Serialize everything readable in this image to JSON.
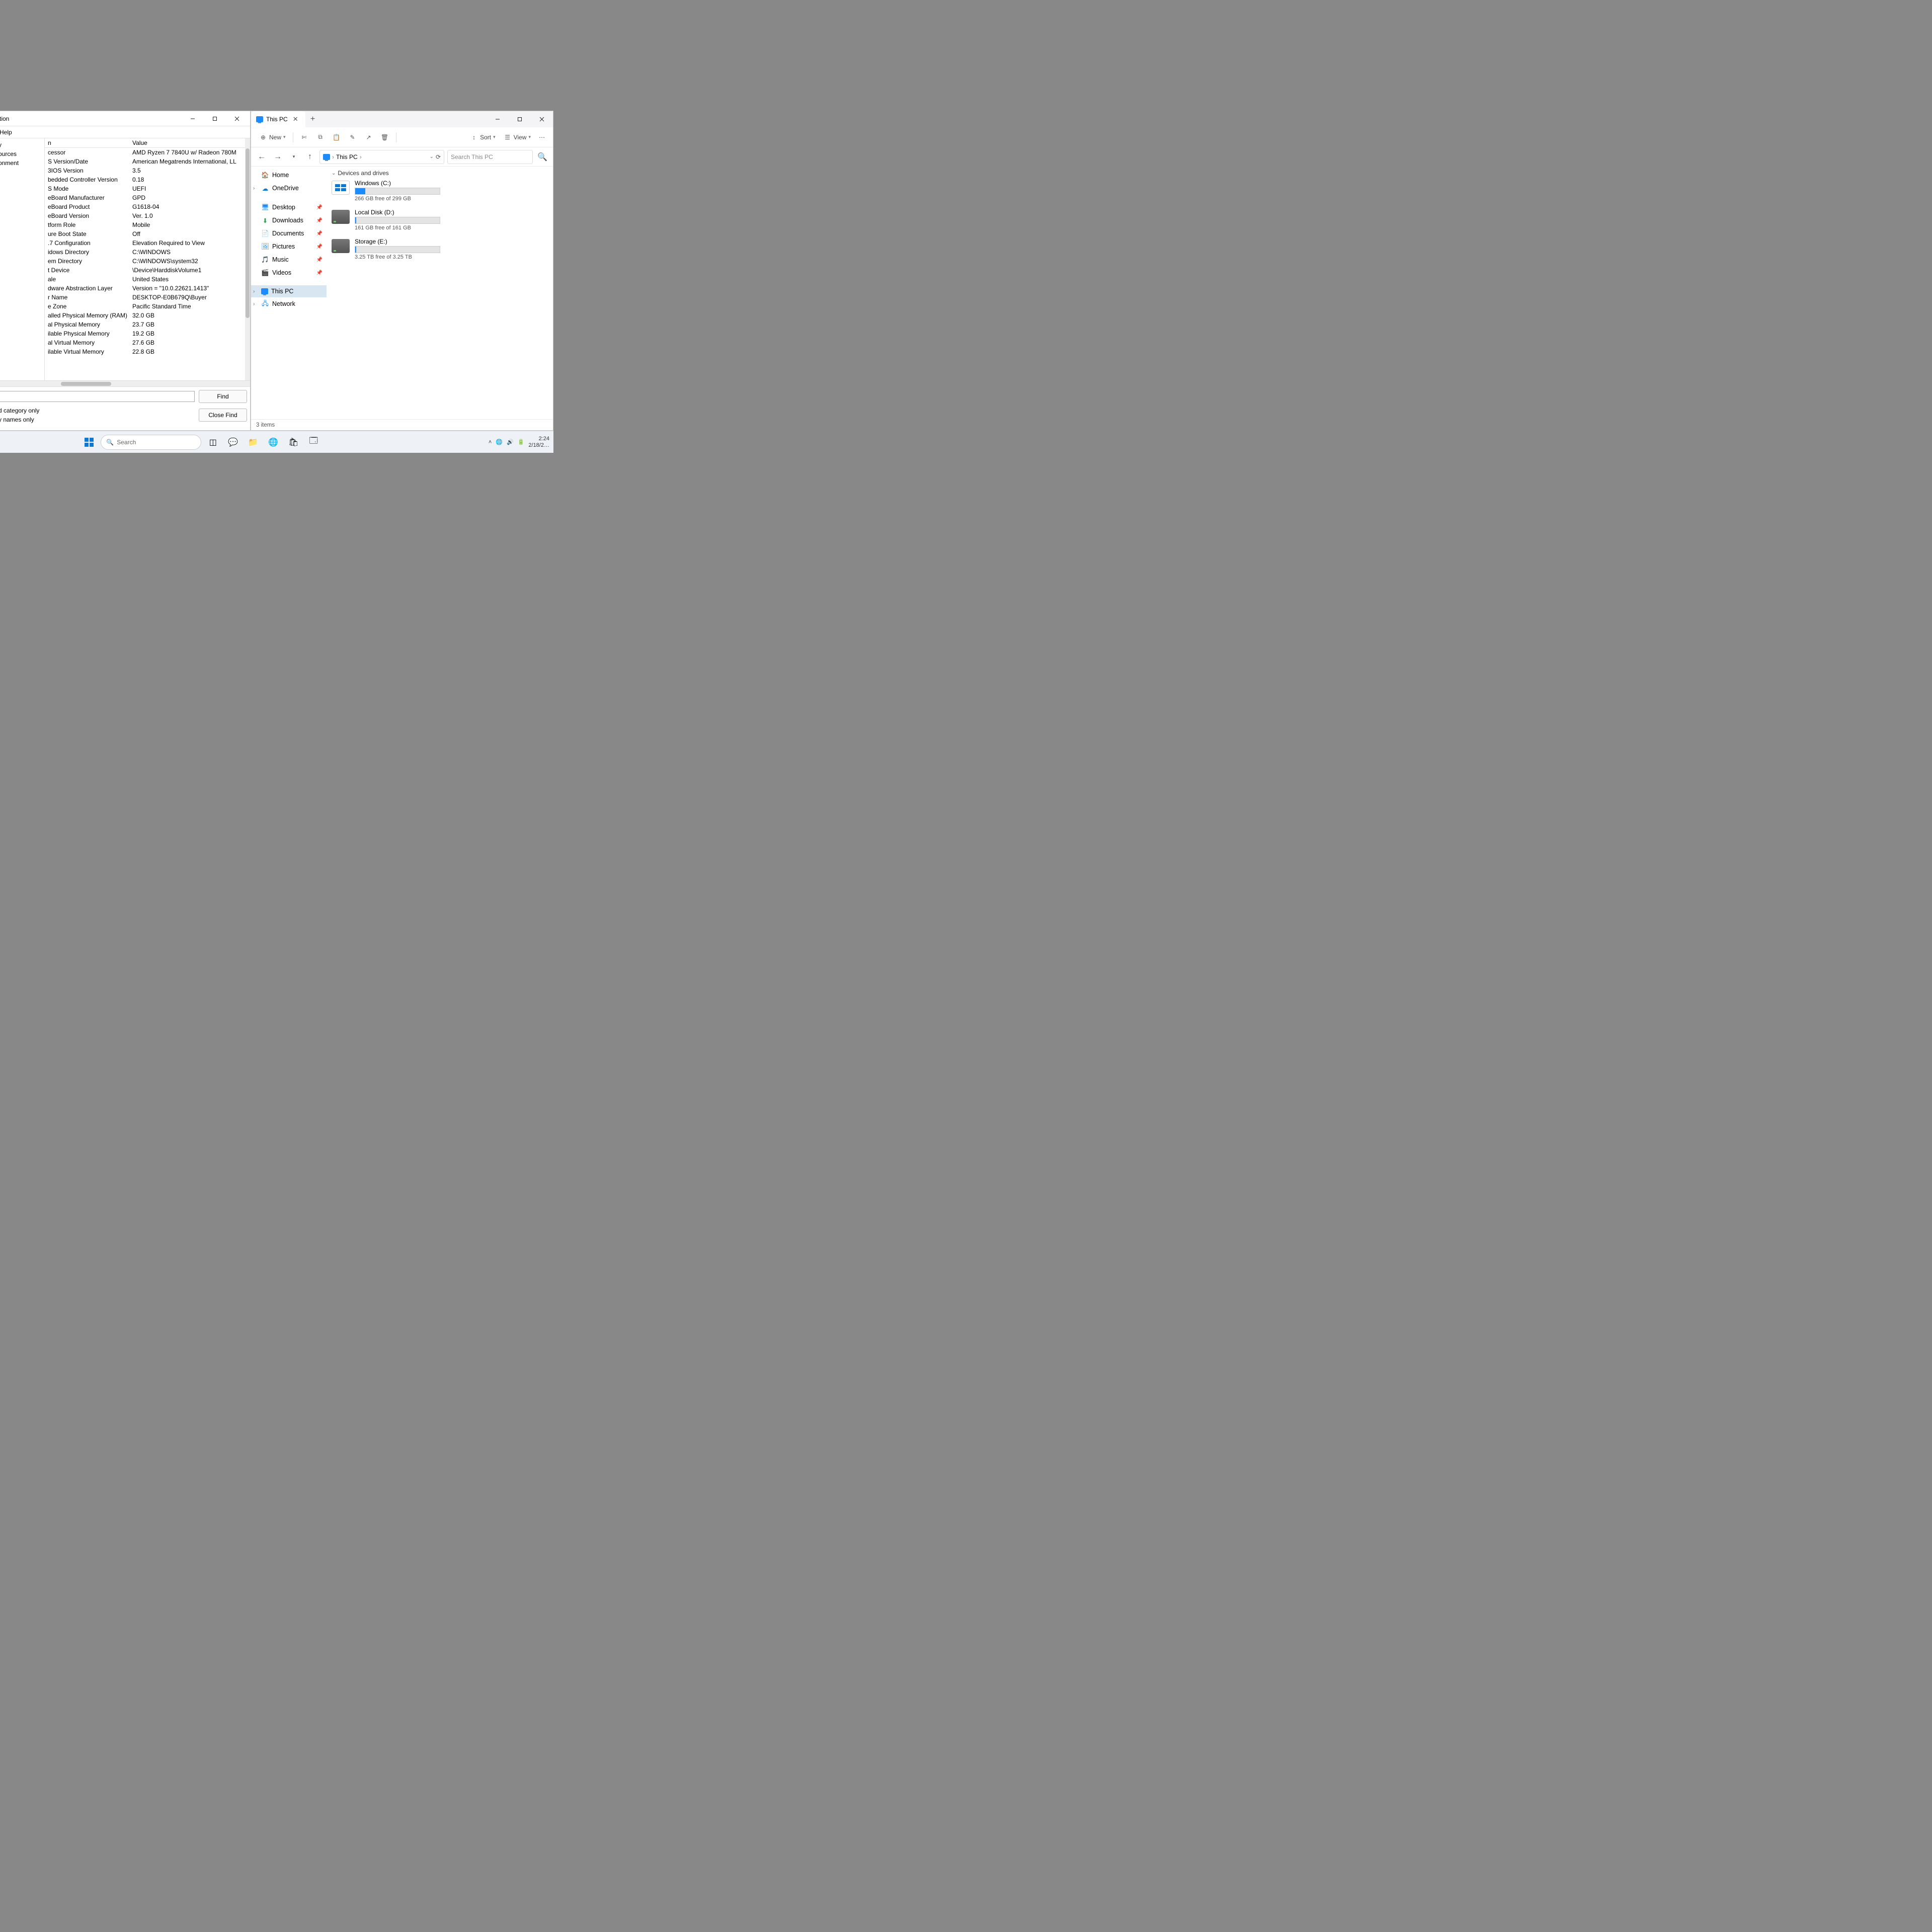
{
  "sysinfo": {
    "title_suffix": "tion",
    "menu": {
      "help": "Help"
    },
    "tree": {
      "row0": "y",
      "row1": "ources",
      "row2": "onment"
    },
    "cols": {
      "key_suffix": "n",
      "val": "Value"
    },
    "rows": [
      {
        "k": "cessor",
        "v": "AMD Ryzen 7 7840U w/ Radeon 780M"
      },
      {
        "k": "S Version/Date",
        "v": "American Megatrends International, LL"
      },
      {
        "k": "3IOS Version",
        "v": "3.5"
      },
      {
        "k": "bedded Controller Version",
        "v": "0.18"
      },
      {
        "k": "S Mode",
        "v": "UEFI"
      },
      {
        "k": "eBoard Manufacturer",
        "v": "GPD"
      },
      {
        "k": "eBoard Product",
        "v": "G1618-04"
      },
      {
        "k": "eBoard Version",
        "v": "Ver. 1.0"
      },
      {
        "k": "tform Role",
        "v": "Mobile"
      },
      {
        "k": "ure Boot State",
        "v": "Off"
      },
      {
        "k": ".7 Configuration",
        "v": "Elevation Required to View"
      },
      {
        "k": "idows Directory",
        "v": "C:\\WINDOWS"
      },
      {
        "k": "em Directory",
        "v": "C:\\WINDOWS\\system32"
      },
      {
        "k": "t Device",
        "v": "\\Device\\HarddiskVolume1"
      },
      {
        "k": "ale",
        "v": "United States"
      },
      {
        "k": "dware Abstraction Layer",
        "v": "Version = \"10.0.22621.1413\""
      },
      {
        "k": "r Name",
        "v": "DESKTOP-E0B679Q\\Buyer"
      },
      {
        "k": "e Zone",
        "v": "Pacific Standard Time"
      },
      {
        "k": "alled Physical Memory (RAM)",
        "v": "32.0 GB"
      },
      {
        "k": "al Physical Memory",
        "v": "23.7 GB"
      },
      {
        "k": "ilable Physical Memory",
        "v": "19.2 GB"
      },
      {
        "k": "al Virtual Memory",
        "v": "27.6 GB"
      },
      {
        "k": "ilable Virtual Memory",
        "v": "22.8 GB"
      }
    ],
    "find_btn": "Find",
    "close_find_btn": "Close Find",
    "check1": "d category only",
    "check2": "y names only"
  },
  "explorer": {
    "tab_title": "This PC",
    "toolbar": {
      "new": "New",
      "sort": "Sort",
      "view": "View"
    },
    "breadcrumb": "This PC",
    "search_placeholder": "Search This PC",
    "nav": {
      "home": "Home",
      "onedrive": "OneDrive",
      "desktop": "Desktop",
      "downloads": "Downloads",
      "documents": "Documents",
      "pictures": "Pictures",
      "music": "Music",
      "videos": "Videos",
      "thispc": "This PC",
      "network": "Network"
    },
    "group": "Devices and drives",
    "drives": [
      {
        "name": "Windows (C:)",
        "free": "266 GB free of 299 GB",
        "fill_pct": 12,
        "icon": "win"
      },
      {
        "name": "Local Disk (D:)",
        "free": "161 GB free of 161 GB",
        "fill_pct": 1,
        "icon": "hdd"
      },
      {
        "name": "Storage (E:)",
        "free": "3.25 TB free of 3.25 TB",
        "fill_pct": 1,
        "icon": "hdd"
      }
    ],
    "status": "3 items"
  },
  "taskbar": {
    "search": "Search",
    "time": "2:24",
    "date": "2/18/2…"
  }
}
